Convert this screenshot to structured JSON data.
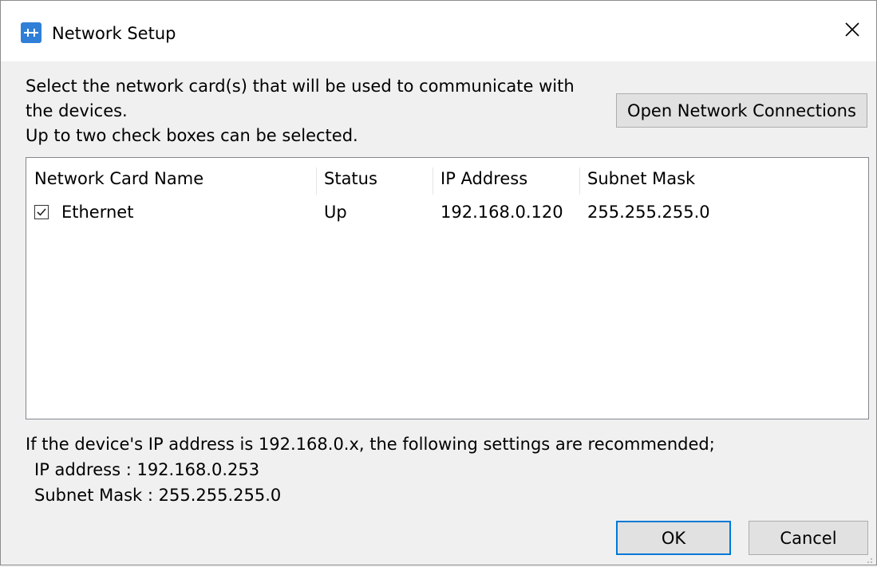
{
  "window": {
    "title": "Network Setup",
    "icon": "network-app-icon",
    "close_icon": "close-icon",
    "accent_color": "#0078d7"
  },
  "instructions": {
    "line1": "Select the network card(s) that will be used to communicate with",
    "line2": "the devices.",
    "line3": "Up to two check boxes can be selected."
  },
  "open_network_connections_label": "Open Network Connections",
  "table": {
    "columns": [
      "Network Card Name",
      "Status",
      "IP Address",
      "Subnet Mask"
    ],
    "rows": [
      {
        "checked": true,
        "name": "Ethernet",
        "status": "Up",
        "ip": "192.168.0.120",
        "subnet": "255.255.255.0"
      }
    ]
  },
  "recommendation": {
    "intro": "If the device's IP address is 192.168.0.x, the following settings are recommended;",
    "ip_line": "IP address : 192.168.0.253",
    "subnet_line": "Subnet Mask : 255.255.255.0"
  },
  "buttons": {
    "ok": "OK",
    "cancel": "Cancel"
  }
}
